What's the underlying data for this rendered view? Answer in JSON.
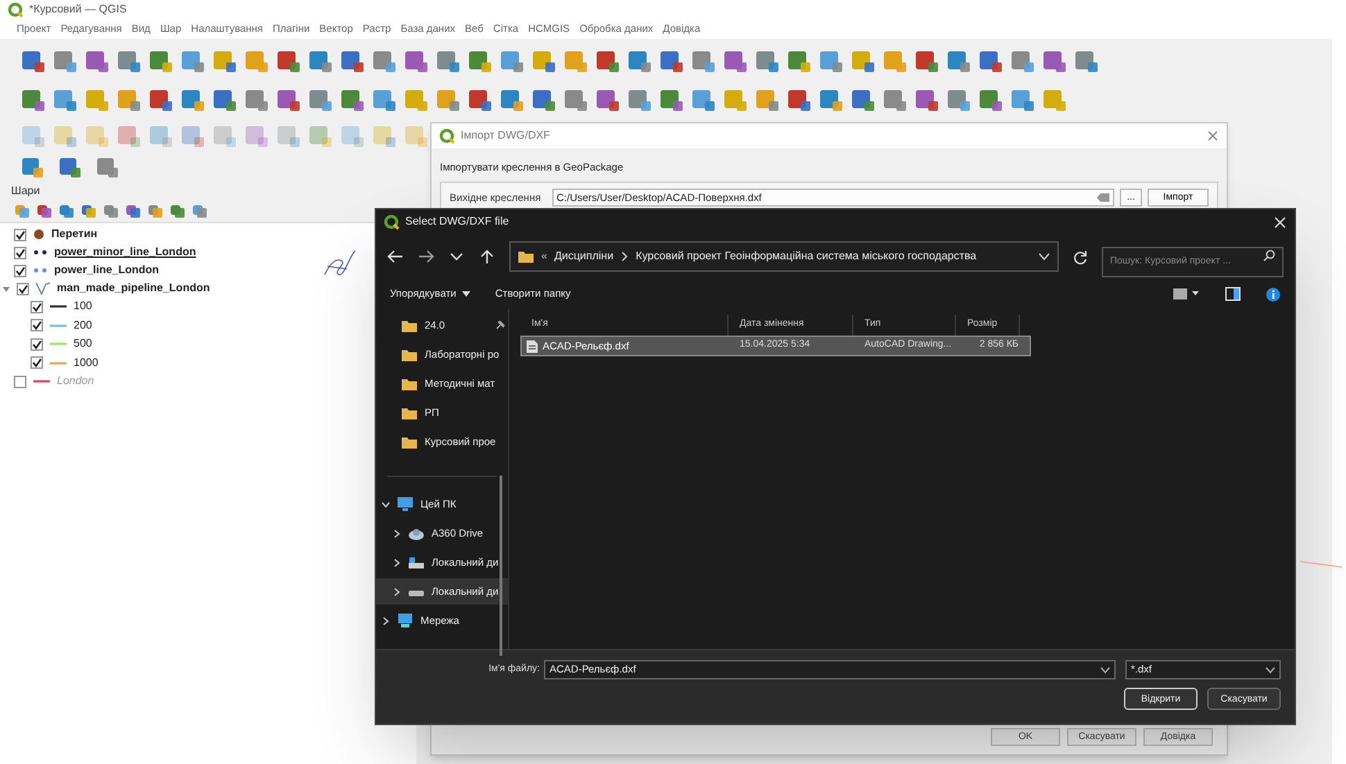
{
  "main_window": {
    "title": "*Курсовий — QGIS",
    "menu": [
      "Проект",
      "Редагування",
      "Вид",
      "Шар",
      "Налаштування",
      "Плагіни",
      "Вектор",
      "Растр",
      "База даних",
      "Веб",
      "Сітка",
      "HCMGIS",
      "Обробка даних",
      "Довідка"
    ]
  },
  "layers_panel": {
    "title": "Шари",
    "layers": [
      {
        "name": "Перетин",
        "checked": true,
        "current": false,
        "kind": "point",
        "color": "#8b4a1f"
      },
      {
        "name": "power_minor_line_London",
        "checked": true,
        "current": true,
        "kind": "dots",
        "color": "#1f2a6b"
      },
      {
        "name": "power_line_London",
        "checked": true,
        "current": false,
        "kind": "dots",
        "color": "#6b8fd6"
      },
      {
        "name": "man_made_pipeline_London",
        "checked": true,
        "current": false,
        "kind": "graduated",
        "color": "#7a8a9a",
        "expanded": true,
        "children": [
          {
            "name": "100",
            "checked": true,
            "color": "#333333"
          },
          {
            "name": "200",
            "checked": true,
            "color": "#6ec1e4"
          },
          {
            "name": "500",
            "checked": true,
            "color": "#9be36a"
          },
          {
            "name": "1000",
            "checked": true,
            "color": "#f2a54a"
          }
        ]
      },
      {
        "name": "London",
        "checked": false,
        "current": false,
        "kind": "line",
        "color": "#e0405a"
      }
    ]
  },
  "import_dialog": {
    "title": "Імпорт DWG/DXF",
    "group": "Імпортувати креслення в GeoPackage",
    "source_label": "Вихідне креслення",
    "source_value": "C:/Users/User/Desktop/ACAD-Поверхня.dxf",
    "browse_button": "...",
    "import_button": "Імпорт",
    "buttons": [
      "OK",
      "Скасувати",
      "Довідка"
    ]
  },
  "file_dialog": {
    "title": "Select DWG/DXF file",
    "overflow_mark": "«",
    "breadcrumb": [
      "Дисципліни",
      "Курсовий проект Геоінформаційна система міського господарства"
    ],
    "search_placeholder": "Пошук: Курсовий проект ...",
    "commands": [
      "Упорядкувати",
      "Створити папку"
    ],
    "nav": [
      {
        "label": "24.0",
        "kind": "folder",
        "pinned": true,
        "selected": false
      },
      {
        "label": "Лабораторні ро",
        "kind": "folder",
        "pinned": false,
        "selected": false
      },
      {
        "label": "Методичні мат",
        "kind": "folder",
        "pinned": false,
        "selected": false
      },
      {
        "label": "РП",
        "kind": "folder",
        "pinned": false,
        "selected": false
      },
      {
        "label": "Курсовий прое",
        "kind": "folder",
        "pinned": false,
        "selected": false
      },
      {
        "label": "Цей ПК",
        "kind": "pc",
        "expanded": true,
        "selected": false,
        "children": [
          {
            "label": "A360 Drive",
            "kind": "cloud",
            "expanded": false,
            "selected": false
          },
          {
            "label": "Локальний ди",
            "kind": "disk",
            "expanded": false,
            "selected": false
          },
          {
            "label": "Локальний ди",
            "kind": "drive",
            "expanded": false,
            "selected": true
          }
        ]
      },
      {
        "label": "Мережа",
        "kind": "network",
        "expanded": false,
        "selected": false
      }
    ],
    "columns": [
      "Ім'я",
      "Дата змінення",
      "Тип",
      "Розмір"
    ],
    "files": [
      {
        "name": "ACAD-Рельєф.dxf",
        "date": "15.04.2025 5:34",
        "type": "AutoCAD Drawing...",
        "size": "2 856 КБ",
        "selected": true
      }
    ],
    "file_name_label": "Ім'я файлу:",
    "file_name": "ACAD-Рельєф.dxf",
    "filter": "*.dxf",
    "buttons": [
      "Відкрити",
      "Скасувати"
    ]
  }
}
